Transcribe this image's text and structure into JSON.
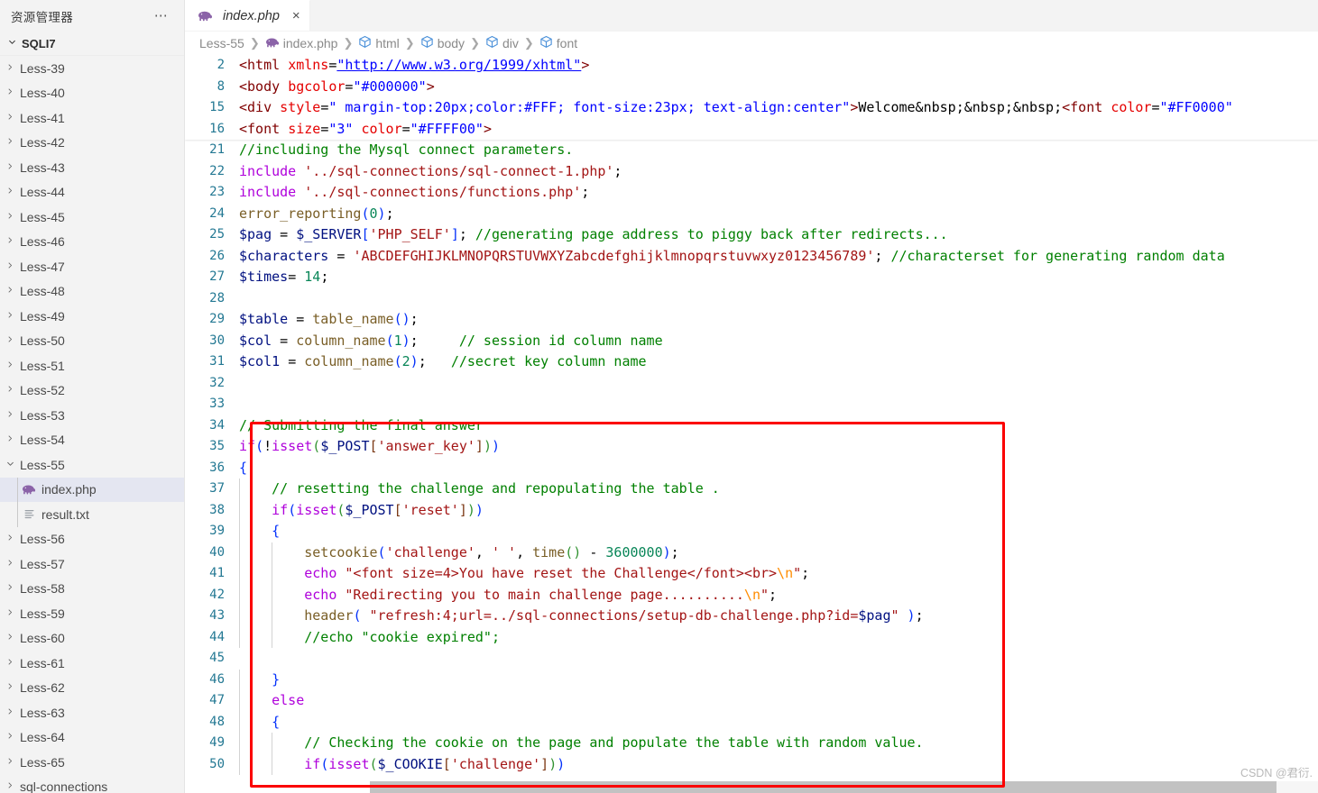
{
  "sidebar": {
    "header_title": "资源管理器",
    "more_icon": "ellipsis-icon",
    "root_label": "SQLI7",
    "items": [
      {
        "label": "Less-39",
        "type": "folder",
        "depth": 1,
        "expanded": false
      },
      {
        "label": "Less-40",
        "type": "folder",
        "depth": 1,
        "expanded": false
      },
      {
        "label": "Less-41",
        "type": "folder",
        "depth": 1,
        "expanded": false
      },
      {
        "label": "Less-42",
        "type": "folder",
        "depth": 1,
        "expanded": false
      },
      {
        "label": "Less-43",
        "type": "folder",
        "depth": 1,
        "expanded": false
      },
      {
        "label": "Less-44",
        "type": "folder",
        "depth": 1,
        "expanded": false
      },
      {
        "label": "Less-45",
        "type": "folder",
        "depth": 1,
        "expanded": false
      },
      {
        "label": "Less-46",
        "type": "folder",
        "depth": 1,
        "expanded": false
      },
      {
        "label": "Less-47",
        "type": "folder",
        "depth": 1,
        "expanded": false
      },
      {
        "label": "Less-48",
        "type": "folder",
        "depth": 1,
        "expanded": false
      },
      {
        "label": "Less-49",
        "type": "folder",
        "depth": 1,
        "expanded": false
      },
      {
        "label": "Less-50",
        "type": "folder",
        "depth": 1,
        "expanded": false
      },
      {
        "label": "Less-51",
        "type": "folder",
        "depth": 1,
        "expanded": false
      },
      {
        "label": "Less-52",
        "type": "folder",
        "depth": 1,
        "expanded": false
      },
      {
        "label": "Less-53",
        "type": "folder",
        "depth": 1,
        "expanded": false
      },
      {
        "label": "Less-54",
        "type": "folder",
        "depth": 1,
        "expanded": false
      },
      {
        "label": "Less-55",
        "type": "folder",
        "depth": 1,
        "expanded": true
      },
      {
        "label": "index.php",
        "type": "php",
        "depth": 2,
        "selected": true
      },
      {
        "label": "result.txt",
        "type": "txt",
        "depth": 2,
        "selected": false
      },
      {
        "label": "Less-56",
        "type": "folder",
        "depth": 1,
        "expanded": false
      },
      {
        "label": "Less-57",
        "type": "folder",
        "depth": 1,
        "expanded": false
      },
      {
        "label": "Less-58",
        "type": "folder",
        "depth": 1,
        "expanded": false
      },
      {
        "label": "Less-59",
        "type": "folder",
        "depth": 1,
        "expanded": false
      },
      {
        "label": "Less-60",
        "type": "folder",
        "depth": 1,
        "expanded": false
      },
      {
        "label": "Less-61",
        "type": "folder",
        "depth": 1,
        "expanded": false
      },
      {
        "label": "Less-62",
        "type": "folder",
        "depth": 1,
        "expanded": false
      },
      {
        "label": "Less-63",
        "type": "folder",
        "depth": 1,
        "expanded": false
      },
      {
        "label": "Less-64",
        "type": "folder",
        "depth": 1,
        "expanded": false
      },
      {
        "label": "Less-65",
        "type": "folder",
        "depth": 1,
        "expanded": false
      },
      {
        "label": "sql-connections",
        "type": "folder",
        "depth": 1,
        "expanded": false
      }
    ]
  },
  "tabs": [
    {
      "label": "index.php",
      "icon": "php-elephant-icon",
      "active": true,
      "preview": true,
      "close_label": "×"
    }
  ],
  "breadcrumb": [
    {
      "label": "Less-55",
      "icon": null
    },
    {
      "label": "index.php",
      "icon": "php-elephant-icon"
    },
    {
      "label": "html",
      "icon": "symbol-cube-icon"
    },
    {
      "label": "body",
      "icon": "symbol-cube-icon"
    },
    {
      "label": "div",
      "icon": "symbol-cube-icon"
    },
    {
      "label": "font",
      "icon": "symbol-cube-icon"
    }
  ],
  "breadcrumb_separator": "❯",
  "editor": {
    "language": "php",
    "sticky_lines": [
      {
        "no": "2",
        "text": "<html xmlns=\"http://www.w3.org/1999/xhtml\">"
      },
      {
        "no": "8",
        "text": "<body bgcolor=\"#000000\">"
      },
      {
        "no": "15",
        "text": "<div style=\" margin-top:20px;color:#FFF; font-size:23px; text-align:center\">Welcome&nbsp;&nbsp;&nbsp;<font color=\"#FF0000\""
      },
      {
        "no": "16",
        "text": "<font size=\"3\" color=\"#FFFF00\">"
      }
    ],
    "lines": [
      {
        "no": "21",
        "text": "//including the Mysql connect parameters."
      },
      {
        "no": "22",
        "text": "include '../sql-connections/sql-connect-1.php';"
      },
      {
        "no": "23",
        "text": "include '../sql-connections/functions.php';"
      },
      {
        "no": "24",
        "text": "error_reporting(0);"
      },
      {
        "no": "25",
        "text": "$pag = $_SERVER['PHP_SELF']; //generating page address to piggy back after redirects..."
      },
      {
        "no": "26",
        "text": "$characters = 'ABCDEFGHIJKLMNOPQRSTUVWXYZabcdefghijklmnopqrstuvwxyz0123456789'; //characterset for generating random data"
      },
      {
        "no": "27",
        "text": "$times= 14;"
      },
      {
        "no": "28",
        "text": ""
      },
      {
        "no": "29",
        "text": "$table = table_name();"
      },
      {
        "no": "30",
        "text": "$col = column_name(1);     // session id column name"
      },
      {
        "no": "31",
        "text": "$col1 = column_name(2);   //secret key column name"
      },
      {
        "no": "32",
        "text": ""
      },
      {
        "no": "33",
        "text": ""
      },
      {
        "no": "34",
        "text": "// Submitting the final answer"
      },
      {
        "no": "35",
        "text": "if(!isset($_POST['answer_key']))"
      },
      {
        "no": "36",
        "text": "{"
      },
      {
        "no": "37",
        "text": "    // resetting the challenge and repopulating the table ."
      },
      {
        "no": "38",
        "text": "    if(isset($_POST['reset']))"
      },
      {
        "no": "39",
        "text": "    {"
      },
      {
        "no": "40",
        "text": "        setcookie('challenge', ' ', time() - 3600000);"
      },
      {
        "no": "41",
        "text": "        echo \"<font size=4>You have reset the Challenge</font><br>\\n\";"
      },
      {
        "no": "42",
        "text": "        echo \"Redirecting you to main challenge page..........\\n\";"
      },
      {
        "no": "43",
        "text": "        header( \"refresh:4;url=../sql-connections/setup-db-challenge.php?id=$pag\" );"
      },
      {
        "no": "44",
        "text": "        //echo \"cookie expired\";"
      },
      {
        "no": "45",
        "text": ""
      },
      {
        "no": "46",
        "text": "    }"
      },
      {
        "no": "47",
        "text": "    else"
      },
      {
        "no": "48",
        "text": "    {"
      },
      {
        "no": "49",
        "text": "        // Checking the cookie on the page and populate the table with random value."
      },
      {
        "no": "50",
        "text": "        if(isset($_COOKIE['challenge']))"
      }
    ]
  },
  "annotation": {
    "type": "rectangle-highlight",
    "color": "#fb0000",
    "covers_lines": [
      "34",
      "50"
    ]
  },
  "watermark": {
    "text": "CSDN @君衍."
  },
  "colors": {
    "sidebar_bg": "#f3f3f3",
    "editor_bg": "#ffffff",
    "tab_active_bg": "#ffffff",
    "selection_bg": "#e4e6f1",
    "line_number": "#237893",
    "annotation_red": "#fb0000",
    "php_icon": "#8b63a8"
  }
}
